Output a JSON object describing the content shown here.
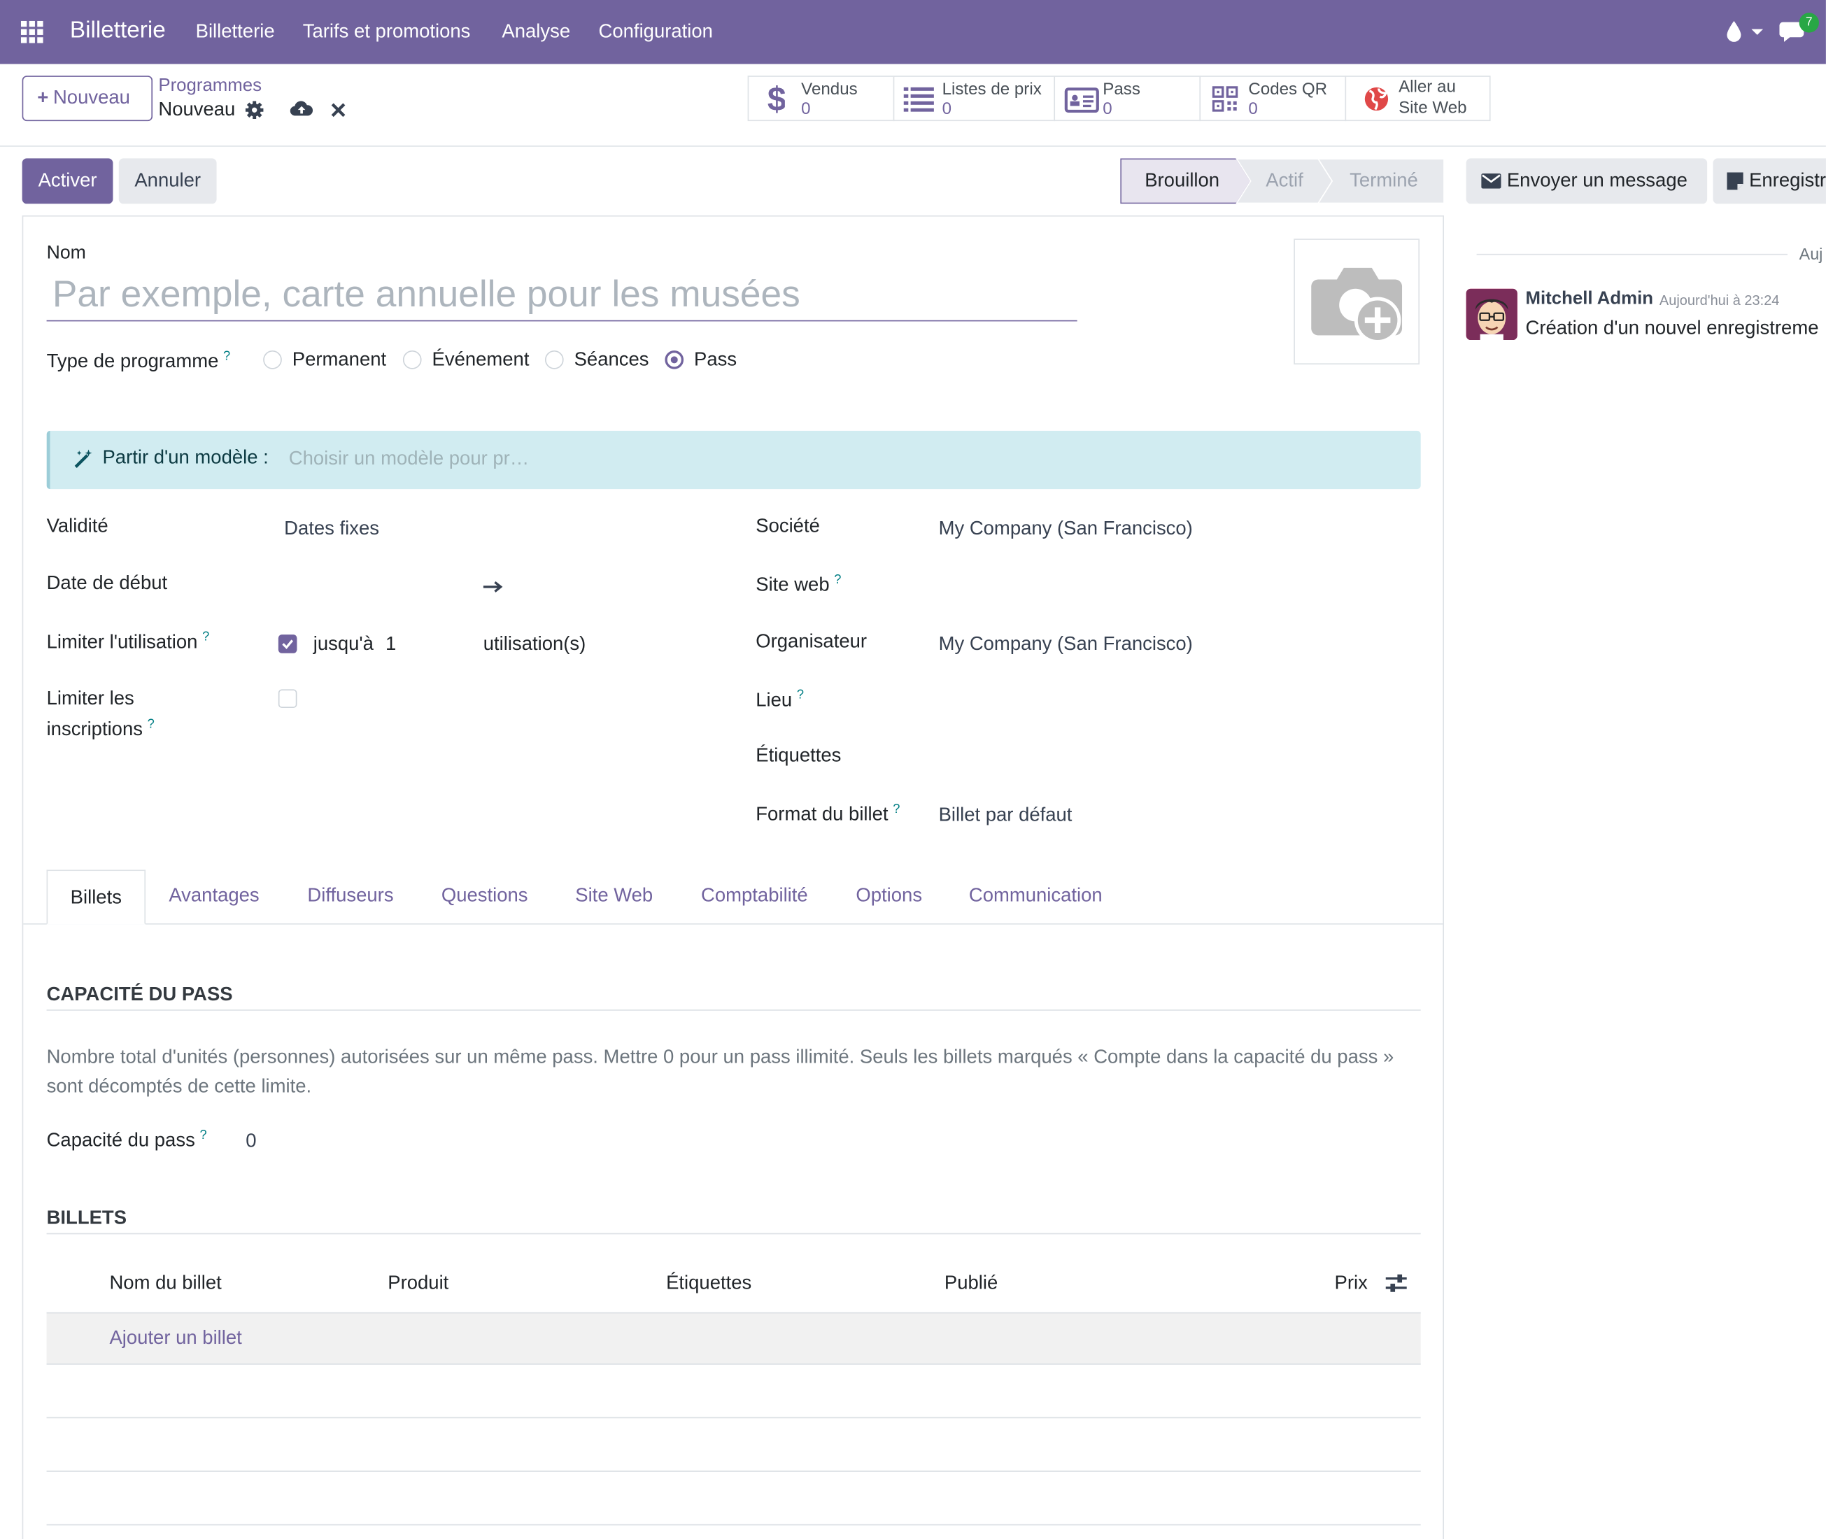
{
  "navbar": {
    "app_name": "Billetterie",
    "menus": [
      "Billetterie",
      "Tarifs et promotions",
      "Analyse",
      "Configuration"
    ],
    "message_count": "7",
    "bg_color": "#71639e"
  },
  "control_panel": {
    "new_button": "Nouveau",
    "breadcrumb_parent": "Programmes",
    "breadcrumb_current": "Nouveau",
    "icons": [
      "gear-icon",
      "cloud-upload-icon",
      "close-icon"
    ],
    "smart_buttons": [
      {
        "label": "Vendus",
        "value": "0",
        "icon": "dollar-icon"
      },
      {
        "label": "Listes de prix",
        "value": "0",
        "icon": "list-icon"
      },
      {
        "label": "Pass",
        "value": "0",
        "icon": "id-card-icon"
      },
      {
        "label": "Codes QR",
        "value": "0",
        "icon": "qrcode-icon"
      },
      {
        "label_line1": "Aller au",
        "label_line2": "Site Web",
        "icon": "globe-icon"
      }
    ]
  },
  "status_bar": {
    "activate": "Activer",
    "cancel": "Annuler",
    "stages": [
      "Brouillon",
      "Actif",
      "Terminé"
    ],
    "current_stage": "Brouillon"
  },
  "chatter": {
    "send_message": "Envoyer un message",
    "log_note": "Enregistr",
    "date_separator": "Auj",
    "author": "Mitchell Admin",
    "time": "Aujourd'hui à 23:24",
    "message": "Création d'un nouvel enregistreme"
  },
  "form": {
    "name_label": "Nom",
    "name_placeholder": "Par exemple, carte annuelle pour les musées",
    "program_type_label": "Type de programme",
    "program_types": [
      "Permanent",
      "Événement",
      "Séances",
      "Pass"
    ],
    "selected_type": "Pass",
    "template_label": "Partir d'un modèle :",
    "template_placeholder": "Choisir un modèle pour pr…",
    "validity_label": "Validité",
    "validity_value": "Dates fixes",
    "start_date_label": "Date de début",
    "limit_usage_label": "Limiter l'utilisation",
    "limit_usage_checked": true,
    "until_label": "jusqu'à",
    "usage_count": "1",
    "usage_unit": "utilisation(s)",
    "limit_reg_label_line1": "Limiter les",
    "limit_reg_label_line2": "inscriptions",
    "limit_reg_checked": false,
    "company_label": "Société",
    "company_value": "My Company (San Francisco)",
    "website_label": "Site web",
    "organizer_label": "Organisateur",
    "organizer_value": "My Company (San Francisco)",
    "place_label": "Lieu",
    "tags_label": "Étiquettes",
    "ticket_format_label": "Format du billet",
    "ticket_format_value": "Billet par défaut"
  },
  "tabs": [
    "Billets",
    "Avantages",
    "Diffuseurs",
    "Questions",
    "Site Web",
    "Comptabilité",
    "Options",
    "Communication"
  ],
  "active_tab": "Billets",
  "billets_tab": {
    "capacity_title": "CAPACITÉ DU PASS",
    "capacity_desc": "Nombre total d'unités (personnes) autorisées sur un même pass. Mettre 0 pour un pass illimité. Seuls les billets marqués « Compte dans la capacité du pass » sont décomptés de cette limite.",
    "capacity_label": "Capacité du pass",
    "capacity_value": "0",
    "tickets_title": "BILLETS",
    "columns": [
      "Nom du billet",
      "Produit",
      "Étiquettes",
      "Publié",
      "Prix"
    ],
    "add_line": "Ajouter un billet"
  }
}
